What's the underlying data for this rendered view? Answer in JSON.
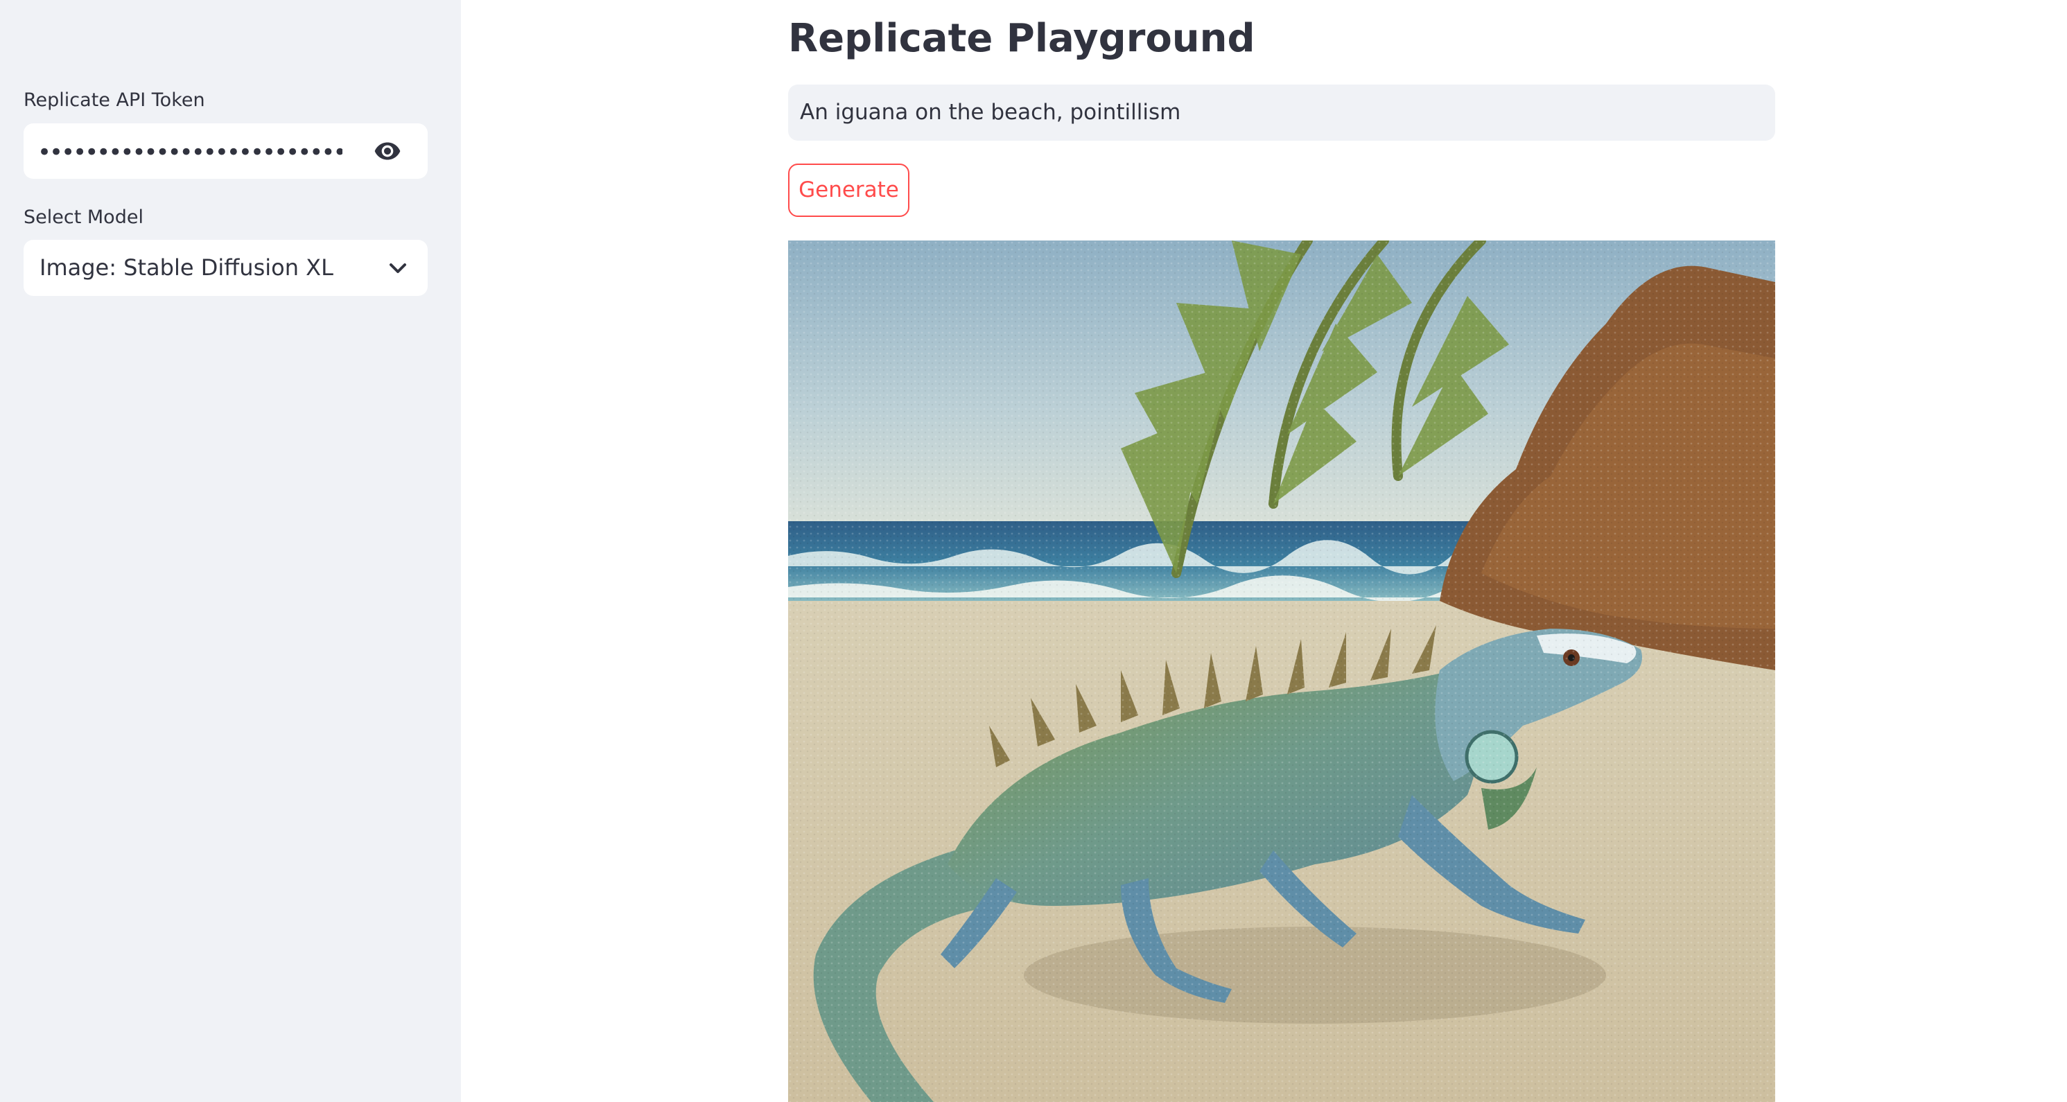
{
  "sidebar": {
    "token_label": "Replicate API Token",
    "token_value": "••••••••••••••••••••••••••••••••••••••",
    "token_reveal_icon": "eye-icon",
    "model_label": "Select Model",
    "model_selected": "Image: Stable Diffusion XL",
    "model_dropdown_icon": "chevron-down-icon"
  },
  "main": {
    "title": "Replicate Playground",
    "prompt_value": "An iguana on the beach, pointillism",
    "generate_label": "Generate",
    "image_subject": "iguana on beach with palm frond and rock, pointillism style"
  },
  "colors": {
    "sidebar_bg": "#f0f2f6",
    "accent": "#ff4b4b",
    "text": "#31333f"
  }
}
